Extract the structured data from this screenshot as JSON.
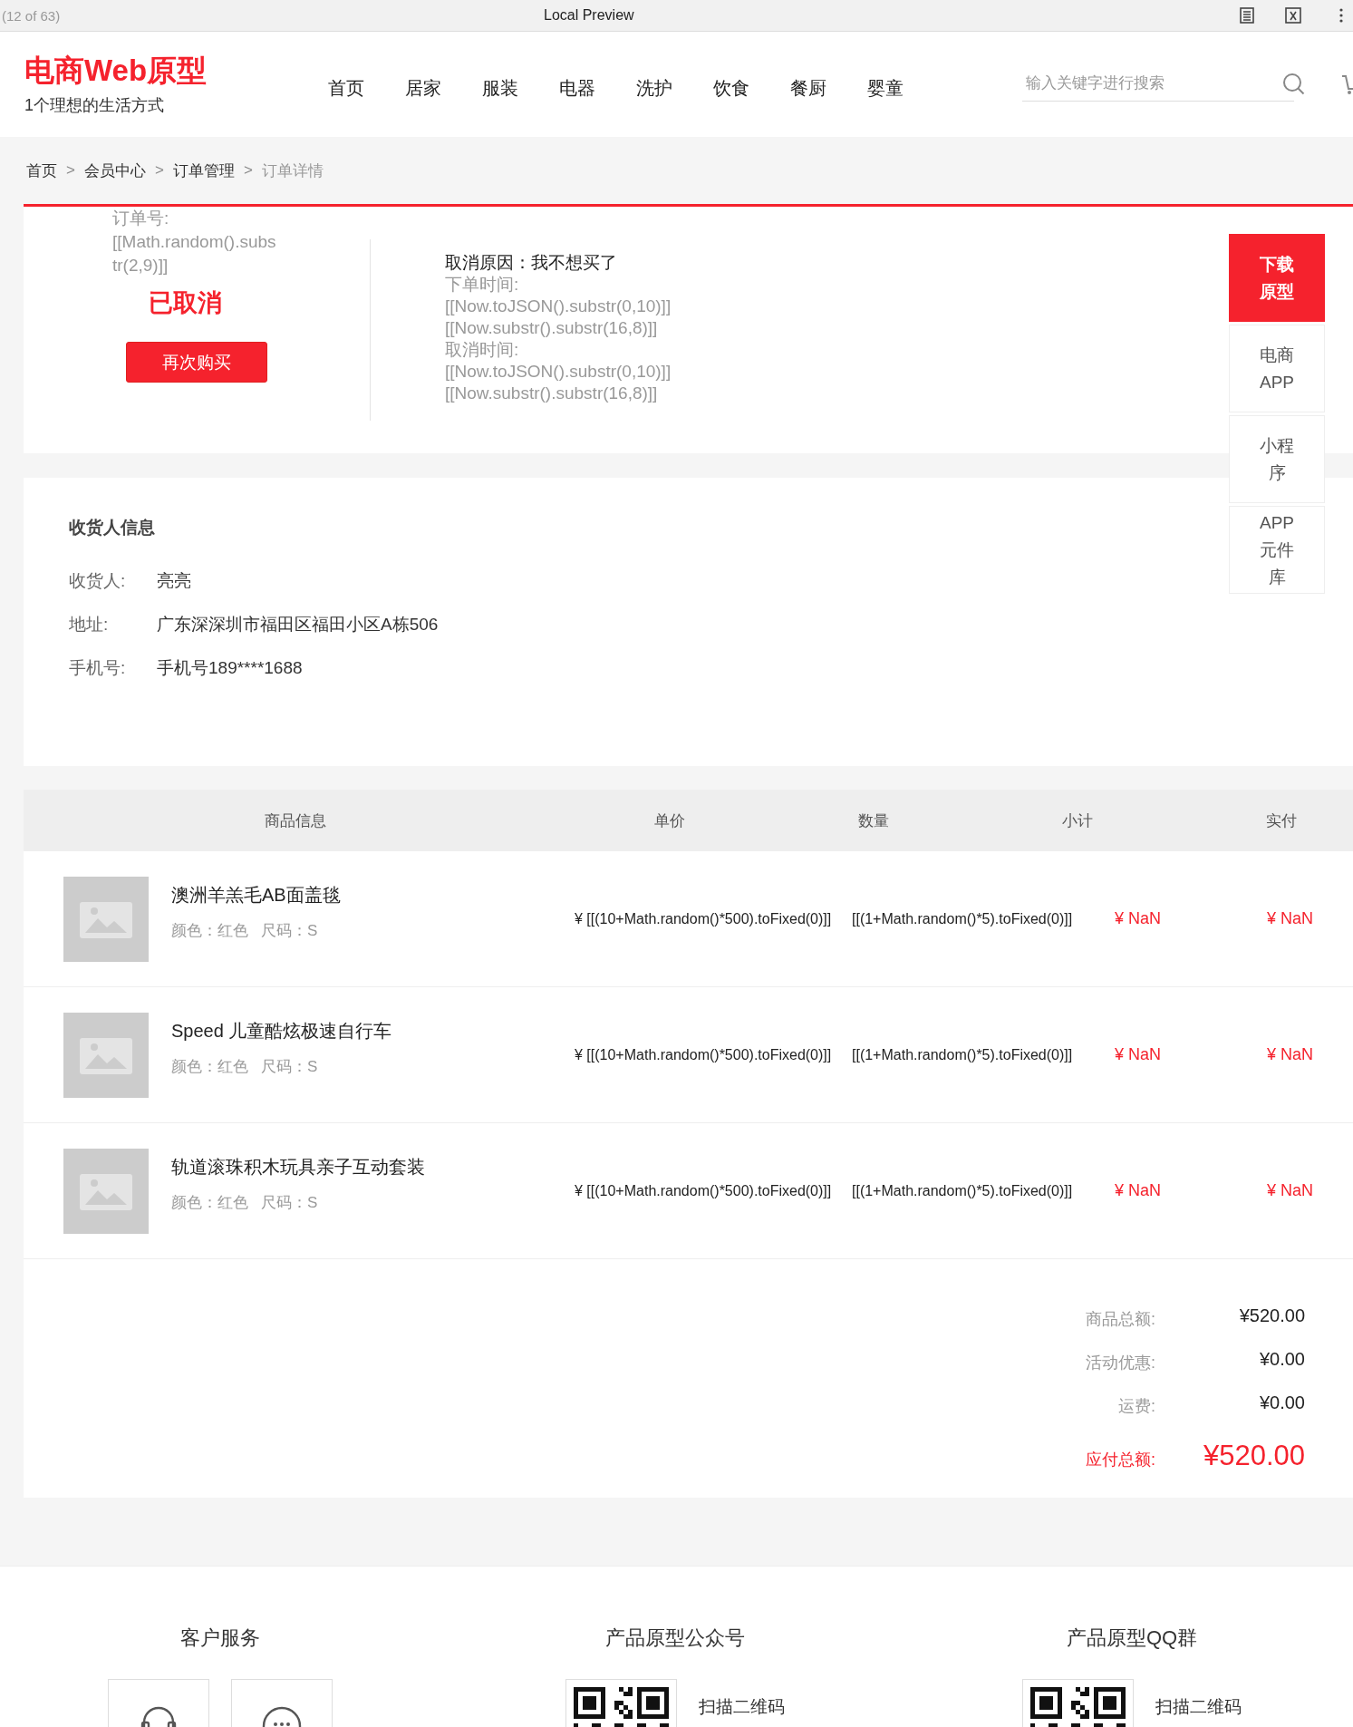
{
  "browser_bar": {
    "page_counter": "(12 of 63)",
    "title": "Local Preview"
  },
  "header": {
    "logo": "电商Web原型",
    "slogan": "1个理想的生活方式",
    "nav": [
      {
        "label": "首页"
      },
      {
        "label": "居家"
      },
      {
        "label": "服装"
      },
      {
        "label": "电器"
      },
      {
        "label": "洗护"
      },
      {
        "label": "饮食"
      },
      {
        "label": "餐厨"
      },
      {
        "label": "婴童"
      }
    ],
    "search": {
      "placeholder": "输入关键字进行搜索"
    }
  },
  "breadcrumb": [
    {
      "label": "首页",
      "separator": ">",
      "current": false
    },
    {
      "label": "会员中心",
      "separator": ">",
      "current": false
    },
    {
      "label": "订单管理",
      "separator": ">",
      "current": false
    },
    {
      "label": "订单详情",
      "current": true
    }
  ],
  "order": {
    "number_label": "订单号:",
    "number_value": "[[Math.random().substr(2,9)]]",
    "status": "已取消",
    "rebuy_button": "再次购买",
    "cancel_reason": "取消原因：我不想买了",
    "order_time_label": "下单时间:",
    "order_date": "[[Now.toJSON().substr(0,10)]]",
    "order_clock": "[[Now.substr().substr(16,8)]]",
    "cancel_time_label": "取消时间:",
    "cancel_date": "[[Now.toJSON().substr(0,10)]]",
    "cancel_clock": "[[Now.substr().substr(16,8)]]"
  },
  "side_links": [
    {
      "label": "下载原型",
      "highlight": true
    },
    {
      "label": "电商APP",
      "highlight": false
    },
    {
      "label": "小程序",
      "highlight": false
    },
    {
      "label": "APP元件库",
      "highlight": false
    }
  ],
  "receiver": {
    "title": "收货人信息",
    "fields": [
      {
        "label": "收货人:",
        "value": "亮亮"
      },
      {
        "label": "地址:",
        "value": "广东深深圳市福田区福田小区A栋506"
      },
      {
        "label": "手机号:",
        "value": "手机号189****1688"
      }
    ]
  },
  "table": {
    "columns": [
      "商品信息",
      "单价",
      "数量",
      "小计",
      "实付"
    ],
    "rows": [
      {
        "kind": "picture",
        "name": "澳洲羊羔毛AB面盖毯",
        "color_spec": "颜色：红色",
        "size_spec": "尺码：S",
        "price": "¥ [[(10+Math.random()*500).toFixed(0)]]",
        "quantity": "[[(1+Math.random()*5).toFixed(0)]]",
        "subtotal": "¥ NaN",
        "paid": "¥ NaN"
      },
      {
        "kind": "picture",
        "name": "Speed 儿童酷炫极速自行车",
        "color_spec": "颜色：红色",
        "size_spec": "尺码：S",
        "price": "¥ [[(10+Math.random()*500).toFixed(0)]]",
        "quantity": "[[(1+Math.random()*5).toFixed(0)]]",
        "subtotal": "¥ NaN",
        "paid": "¥ NaN"
      },
      {
        "kind": "picture",
        "name": "轨道滚珠积木玩具亲子互动套装",
        "color_spec": "颜色：红色",
        "size_spec": "尺码：S",
        "price": "¥ [[(10+Math.random()*500).toFixed(0)]]",
        "quantity": "[[(1+Math.random()*5).toFixed(0)]]",
        "subtotal": "¥ NaN",
        "paid": "¥ NaN"
      }
    ]
  },
  "totals": [
    {
      "label": "商品总额:",
      "value": "¥520.00",
      "emphasis": false
    },
    {
      "label": "活动优惠:",
      "value": "¥0.00",
      "emphasis": false
    },
    {
      "label": "运费:",
      "value": "¥0.00",
      "emphasis": false
    },
    {
      "label": "应付总额:",
      "value": "¥520.00",
      "emphasis": true
    }
  ],
  "footer": [
    {
      "kind": "service",
      "title": "客户服务"
    },
    {
      "kind": "qr",
      "title": "产品原型公众号",
      "caption": "扫描二维码"
    },
    {
      "kind": "qr",
      "title": "产品原型QQ群",
      "caption": "扫描二维码"
    }
  ]
}
